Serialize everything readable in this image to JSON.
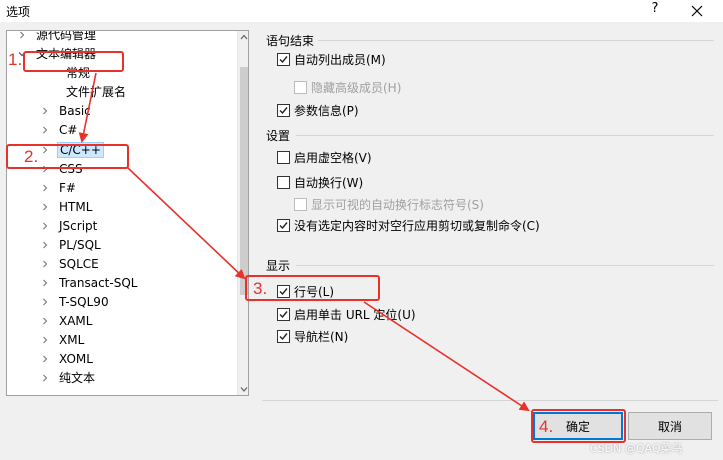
{
  "window": {
    "title": "选项",
    "help": "?"
  },
  "tree": {
    "items": [
      {
        "label": "源代码管理",
        "expand": "collapsed"
      },
      {
        "label": "文本编辑器",
        "expand": "expanded"
      },
      {
        "label": "常规",
        "expand": "none"
      },
      {
        "label": "文件扩展名",
        "expand": "none"
      },
      {
        "label": "Basic",
        "expand": "collapsed"
      },
      {
        "label": "C#",
        "expand": "collapsed"
      },
      {
        "label": "C/C++",
        "expand": "collapsed",
        "selected": true
      },
      {
        "label": "CSS",
        "expand": "collapsed"
      },
      {
        "label": "F#",
        "expand": "collapsed"
      },
      {
        "label": "HTML",
        "expand": "collapsed"
      },
      {
        "label": "JScript",
        "expand": "collapsed"
      },
      {
        "label": "PL/SQL",
        "expand": "collapsed"
      },
      {
        "label": "SQLCE",
        "expand": "collapsed"
      },
      {
        "label": "Transact-SQL",
        "expand": "collapsed"
      },
      {
        "label": "T-SQL90",
        "expand": "collapsed"
      },
      {
        "label": "XAML",
        "expand": "collapsed"
      },
      {
        "label": "XML",
        "expand": "collapsed"
      },
      {
        "label": "XOML",
        "expand": "collapsed"
      },
      {
        "label": "纯文本",
        "expand": "collapsed"
      }
    ]
  },
  "statement_completion": {
    "title": "语句结束",
    "options": [
      {
        "label": "自动列出成员(M)",
        "checked": true,
        "enabled": true
      },
      {
        "label": "隐藏高级成员(H)",
        "checked": false,
        "enabled": false
      },
      {
        "label": "参数信息(P)",
        "checked": true,
        "enabled": true
      }
    ]
  },
  "settings": {
    "title": "设置",
    "options": [
      {
        "label": "启用虚空格(V)",
        "checked": false,
        "enabled": true
      },
      {
        "label": "自动换行(W)",
        "checked": false,
        "enabled": true
      },
      {
        "label": "显示可视的自动换行标志符号(S)",
        "checked": false,
        "enabled": false
      },
      {
        "label": "没有选定内容时对空行应用剪切或复制命令(C)",
        "checked": true,
        "enabled": true
      }
    ]
  },
  "display": {
    "title": "显示",
    "options": [
      {
        "label": "行号(L)",
        "checked": true,
        "enabled": true
      },
      {
        "label": "启用单击 URL 定位(U)",
        "checked": true,
        "enabled": true
      },
      {
        "label": "导航栏(N)",
        "checked": true,
        "enabled": true
      }
    ]
  },
  "buttons": {
    "ok": "确定",
    "cancel": "取消"
  },
  "annotations": {
    "step1": "1.",
    "step2": "2.",
    "step3": "3.",
    "step4": "4.",
    "color": "#e8312a"
  },
  "watermark": "CSDN @QAQ菜鸟"
}
